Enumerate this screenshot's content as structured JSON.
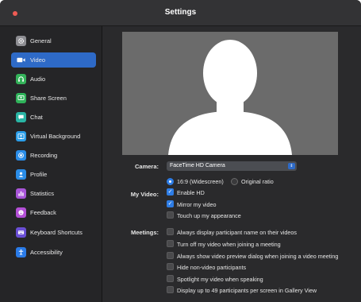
{
  "window": {
    "title": "Settings"
  },
  "sidebar": {
    "items": [
      {
        "label": "General",
        "icon": "gear-icon",
        "color": "#8e8e93",
        "active": false
      },
      {
        "label": "Video",
        "icon": "video-camera-icon",
        "color": "#2e6ac7",
        "active": true
      },
      {
        "label": "Audio",
        "icon": "headphones-icon",
        "color": "#34b35a",
        "active": false
      },
      {
        "label": "Share Screen",
        "icon": "share-screen-icon",
        "color": "#2fb35a",
        "active": false
      },
      {
        "label": "Chat",
        "icon": "chat-bubble-icon",
        "color": "#29b5a4",
        "active": false
      },
      {
        "label": "Virtual Background",
        "icon": "person-background-icon",
        "color": "#2a9de8",
        "active": false
      },
      {
        "label": "Recording",
        "icon": "record-icon",
        "color": "#2a8de8",
        "active": false
      },
      {
        "label": "Profile",
        "icon": "person-icon",
        "color": "#2a8de8",
        "active": false
      },
      {
        "label": "Statistics",
        "icon": "bar-chart-icon",
        "color": "#a855d8",
        "active": false
      },
      {
        "label": "Feedback",
        "icon": "smiley-icon",
        "color": "#b34fd6",
        "active": false
      },
      {
        "label": "Keyboard Shortcuts",
        "icon": "keyboard-icon",
        "color": "#6a4fd6",
        "active": false
      },
      {
        "label": "Accessibility",
        "icon": "accessibility-icon",
        "color": "#2a7be8",
        "active": false
      }
    ]
  },
  "camera": {
    "label": "Camera:",
    "selected": "FaceTime HD Camera"
  },
  "my_video": {
    "label": "My Video:",
    "aspect_options": [
      {
        "label": "16:9 (Widescreen)",
        "selected": true
      },
      {
        "label": "Original ratio",
        "selected": false
      }
    ],
    "options": [
      {
        "label": "Enable HD",
        "checked": true
      },
      {
        "label": "Mirror my video",
        "checked": true
      },
      {
        "label": "Touch up my appearance",
        "checked": false
      }
    ]
  },
  "meetings": {
    "label": "Meetings:",
    "options": [
      {
        "label": "Always display participant name on their videos",
        "checked": false
      },
      {
        "label": "Turn off my video when joining a meeting",
        "checked": false
      },
      {
        "label": "Always show video preview dialog when joining a video meeting",
        "checked": false
      },
      {
        "label": "Hide non-video participants",
        "checked": false
      },
      {
        "label": "Spotlight my video when speaking",
        "checked": false
      },
      {
        "label": "Display up to 49 participants per screen in Gallery View",
        "checked": false
      }
    ]
  },
  "colors": {
    "accent": "#2e6ac7",
    "check_accent": "#2e7de6",
    "close_button": "#ee5b54"
  }
}
